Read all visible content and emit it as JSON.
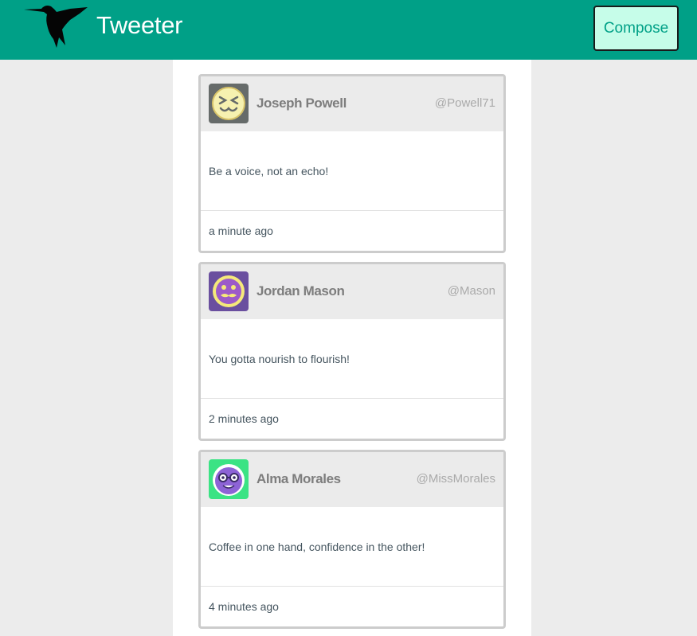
{
  "navbar": {
    "brand": "Tweeter",
    "compose_label": "Compose",
    "logo_icon": "hummingbird-icon",
    "colors": {
      "background": "#00a087",
      "compose_bg": "#c6fde9"
    }
  },
  "tweets": [
    {
      "name": "Joseph Powell",
      "handle": "@Powell71",
      "text": "Be a voice, not an echo!",
      "time": "a minute ago",
      "avatar_icon": "squinting-face-avatar-icon",
      "avatar_bg": "#666b6a"
    },
    {
      "name": "Jordan Mason",
      "handle": "@Mason",
      "text": "You gotta nourish to flourish!",
      "time": "2 minutes ago",
      "avatar_icon": "mustache-face-avatar-icon",
      "avatar_bg": "#6a4f9f"
    },
    {
      "name": "Alma Morales",
      "handle": "@MissMorales",
      "text": "Coffee in one hand, confidence in the other!",
      "time": "4 minutes ago",
      "avatar_icon": "glasses-face-avatar-icon",
      "avatar_bg": "#3be384"
    }
  ]
}
